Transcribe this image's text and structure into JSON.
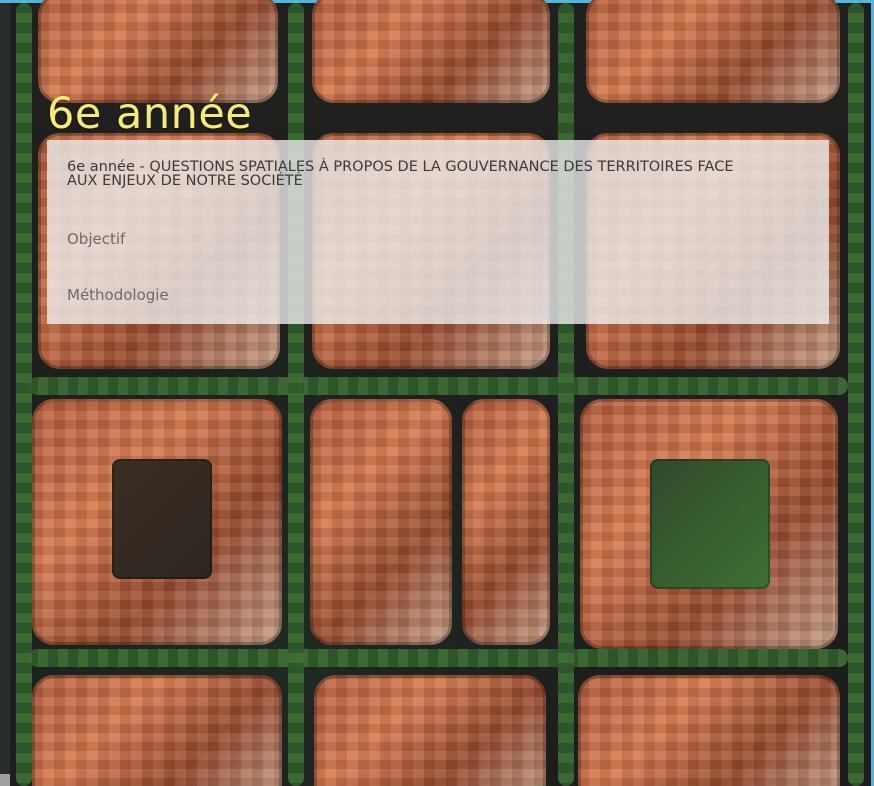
{
  "page": {
    "title": "6e année",
    "title_color": "#f6eb78",
    "accent_color": "#56b3dc"
  },
  "panel": {
    "heading": "6e année - QUESTIONS SPATIALES À PROPOS DE LA GOUVERNANCE DES TERRITOIRES FACE AUX ENJEUX DE NOTRE SOCIÉTÉ",
    "links": [
      {
        "label": "Objectif"
      },
      {
        "label": "Méthodologie"
      }
    ]
  }
}
